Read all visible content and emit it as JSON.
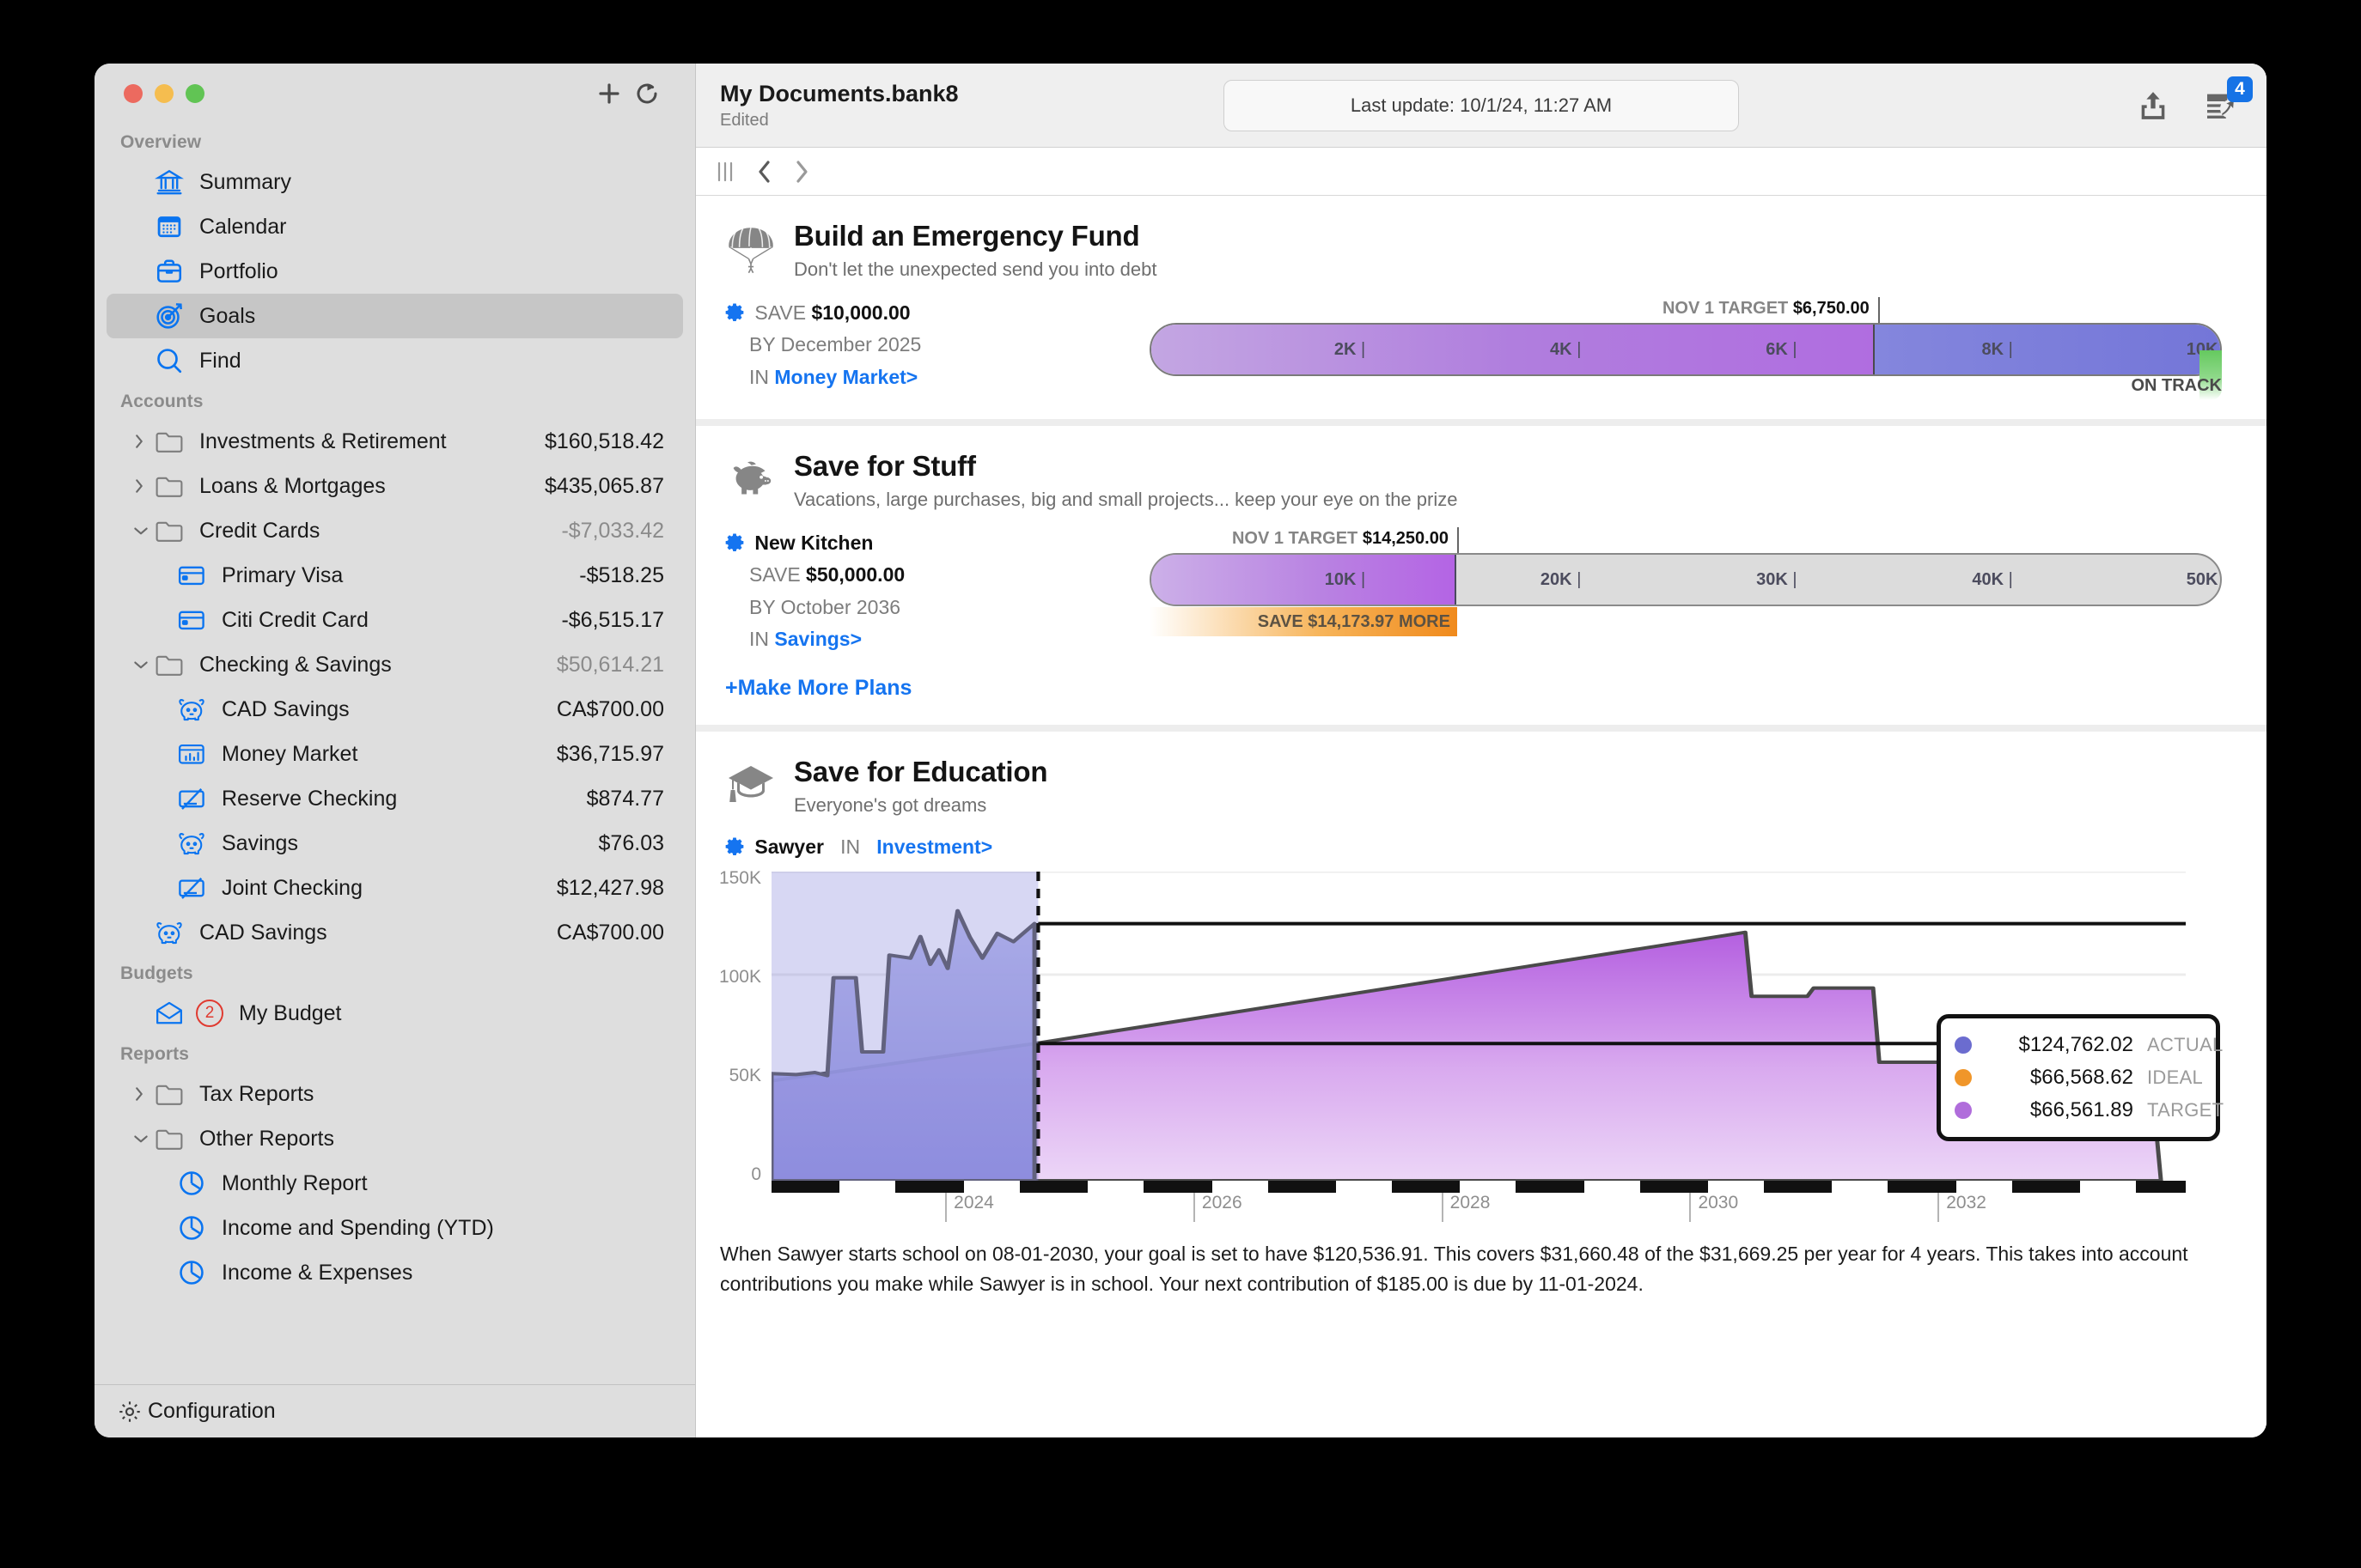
{
  "window": {
    "traffic_lights": [
      "close",
      "minimize",
      "zoom"
    ],
    "sidebar_toolbar": {
      "add_label": "+",
      "refresh_label": "refresh"
    }
  },
  "header": {
    "document_title": "My Documents.bank8",
    "document_state": "Edited",
    "update_pill": "Last update: 10/1/24, 11:27 AM",
    "share_icon": "share-icon",
    "reconcile_icon": "reconcile-icon",
    "reconcile_badge": "4"
  },
  "navbar": {
    "sidebar_toggle": "columns-icon",
    "back": "chevron-left-icon",
    "forward": "chevron-right-icon"
  },
  "sidebar": {
    "groups": [
      {
        "title": "Overview",
        "items": [
          {
            "label": "Summary",
            "icon": "bank-icon",
            "amount": ""
          },
          {
            "label": "Calendar",
            "icon": "calendar-icon",
            "amount": ""
          },
          {
            "label": "Portfolio",
            "icon": "briefcase-icon",
            "amount": ""
          },
          {
            "label": "Goals",
            "icon": "target-icon",
            "amount": "",
            "selected": true
          },
          {
            "label": "Find",
            "icon": "magnifier-icon",
            "amount": ""
          }
        ]
      },
      {
        "title": "Accounts",
        "items": [
          {
            "label": "Investments & Retirement",
            "icon": "folder-icon",
            "amount": "$160,518.42",
            "disclosure": "collapsed"
          },
          {
            "label": "Loans & Mortgages",
            "icon": "folder-icon",
            "amount": "$435,065.87",
            "disclosure": "collapsed"
          },
          {
            "label": "Credit Cards",
            "icon": "folder-icon",
            "amount": "-$7,033.42",
            "disclosure": "expanded",
            "muted": true
          },
          {
            "label": "Primary Visa",
            "icon": "creditcard-icon",
            "amount": "-$518.25",
            "indent": 1
          },
          {
            "label": "Citi Credit Card",
            "icon": "creditcard-icon",
            "amount": "-$6,515.17",
            "indent": 1
          },
          {
            "label": "Checking & Savings",
            "icon": "folder-icon",
            "amount": "$50,614.21",
            "disclosure": "expanded",
            "muted": true
          },
          {
            "label": "CAD Savings",
            "icon": "piggy-icon",
            "amount": "CA$700.00",
            "indent": 1
          },
          {
            "label": "Money Market",
            "icon": "moneymarket-icon",
            "amount": "$36,715.97",
            "indent": 1
          },
          {
            "label": "Reserve Checking",
            "icon": "check-icon",
            "amount": "$874.77",
            "indent": 1
          },
          {
            "label": "Savings",
            "icon": "piggy-icon",
            "amount": "$76.03",
            "indent": 1
          },
          {
            "label": "Joint Checking",
            "icon": "check-icon",
            "amount": "$12,427.98",
            "indent": 1
          },
          {
            "label": "CAD Savings",
            "icon": "piggy-icon",
            "amount": "CA$700.00",
            "indent": 0
          }
        ]
      },
      {
        "title": "Budgets",
        "items": [
          {
            "label": "My Budget",
            "icon": "envelope-icon",
            "badge": "2",
            "amount": ""
          }
        ]
      },
      {
        "title": "Reports",
        "items": [
          {
            "label": "Tax Reports",
            "icon": "folder-icon",
            "amount": "",
            "disclosure": "collapsed"
          },
          {
            "label": "Other Reports",
            "icon": "folder-icon",
            "amount": "",
            "disclosure": "expanded"
          },
          {
            "label": "Monthly Report",
            "icon": "piechart-icon",
            "amount": "",
            "indent": 1
          },
          {
            "label": "Income and Spending (YTD)",
            "icon": "piechart-icon",
            "amount": "",
            "indent": 1
          },
          {
            "label": "Income & Expenses",
            "icon": "piechart-icon",
            "amount": "",
            "indent": 1
          }
        ]
      }
    ],
    "configuration": {
      "label": "Configuration",
      "icon": "gear-icon"
    }
  },
  "goals": [
    {
      "icon": "parachute-icon",
      "title": "Build an Emergency Fund",
      "subtitle": "Don't let the unexpected send you into debt",
      "plan": {
        "save_label": "SAVE",
        "save_amount": "$10,000.00",
        "by_label": "BY",
        "by_value": "December 2025",
        "in_label": "IN",
        "in_account": "Money Market>"
      },
      "progress": {
        "target_prefix": "NOV 1 TARGET",
        "target_amount": "$6,750.00",
        "target_pct": 67.5,
        "fill_pct": 100,
        "ticks": [
          "2K",
          "4K",
          "6K",
          "8K",
          "10K"
        ],
        "status": "ON TRACK"
      }
    },
    {
      "icon": "piggy-icon",
      "title": "Save for Stuff",
      "subtitle": "Vacations, large purchases, big and small projects... keep your eye on the prize",
      "plan": {
        "name": "New Kitchen",
        "save_label": "SAVE",
        "save_amount": "$50,000.00",
        "by_label": "BY",
        "by_value": "October 2036",
        "in_label": "IN",
        "in_account": "Savings>"
      },
      "progress": {
        "target_prefix": "NOV 1 TARGET",
        "target_amount": "$14,250.00",
        "target_pct": 28.5,
        "fill_pct": 28.5,
        "ticks": [
          "10K",
          "20K",
          "30K",
          "40K",
          "50K"
        ],
        "shortfall": "SAVE $14,173.97 MORE"
      },
      "make_more_plans": "Make More Plans"
    },
    {
      "icon": "graduation-icon",
      "title": "Save for Education",
      "subtitle": "Everyone's got dreams",
      "plan": {
        "name": "Sawyer",
        "in_label": "IN",
        "in_account": "Investment>"
      },
      "blurb": "When Sawyer starts school on 08-01-2030, your goal is set to have $120,536.91. This covers $31,660.48 of the $31,669.25 per year for 4 years. This takes into account contributions you make while Sawyer is in school. Your next contribution of $185.00 is due by 11-01-2024."
    }
  ],
  "chart_data": {
    "type": "area",
    "title": "Save for Education — Sawyer",
    "xlabel": "",
    "ylabel": "",
    "ylim": [
      0,
      150000
    ],
    "ytick_labels": [
      "150K",
      "100K",
      "50K",
      "0"
    ],
    "ytick_values": [
      150000,
      100000,
      50000,
      0
    ],
    "xtick_labels": [
      "2024",
      "2026",
      "2028",
      "2030",
      "2032"
    ],
    "xlim": [
      2022.6,
      2034.0
    ],
    "today_marker": 2024.75,
    "grid": true,
    "legend_position": "right",
    "series": [
      {
        "name": "ACTUAL",
        "color": "#6b6ccf",
        "value_label": "$124,762.02",
        "value": 124762.02,
        "points": [
          [
            2022.6,
            52000
          ],
          [
            2022.8,
            51500
          ],
          [
            2022.95,
            52500
          ],
          [
            2023.05,
            51000
          ],
          [
            2023.1,
            98500
          ],
          [
            2023.28,
            98500
          ],
          [
            2023.33,
            62500
          ],
          [
            2023.5,
            62500
          ],
          [
            2023.55,
            109500
          ],
          [
            2023.72,
            108000
          ],
          [
            2023.8,
            118500
          ],
          [
            2023.88,
            105000
          ],
          [
            2023.95,
            112000
          ],
          [
            2024.02,
            103000
          ],
          [
            2024.1,
            131000
          ],
          [
            2024.2,
            118000
          ],
          [
            2024.3,
            108000
          ],
          [
            2024.42,
            120000
          ],
          [
            2024.55,
            116000
          ],
          [
            2024.72,
            124762
          ]
        ]
      },
      {
        "name": "IDEAL",
        "color": "#f0962a",
        "value_label": "$66,568.62",
        "value": 66568.62
      },
      {
        "name": "TARGET",
        "color": "#b06ddb",
        "value_label": "$66,561.89",
        "value": 66561.89,
        "points": [
          [
            2022.6,
            48500
          ],
          [
            2024.72,
            66562
          ],
          [
            2030.45,
            120537
          ],
          [
            2030.5,
            89500
          ],
          [
            2030.95,
            89500
          ],
          [
            2031.0,
            93500
          ],
          [
            2031.48,
            93500
          ],
          [
            2031.53,
            57500
          ],
          [
            2032.05,
            57500
          ],
          [
            2032.1,
            59500
          ],
          [
            2032.48,
            59500
          ],
          [
            2032.53,
            30500
          ],
          [
            2033.05,
            30500
          ],
          [
            2033.1,
            32500
          ],
          [
            2033.75,
            32500
          ],
          [
            2033.8,
            0
          ]
        ]
      }
    ]
  }
}
